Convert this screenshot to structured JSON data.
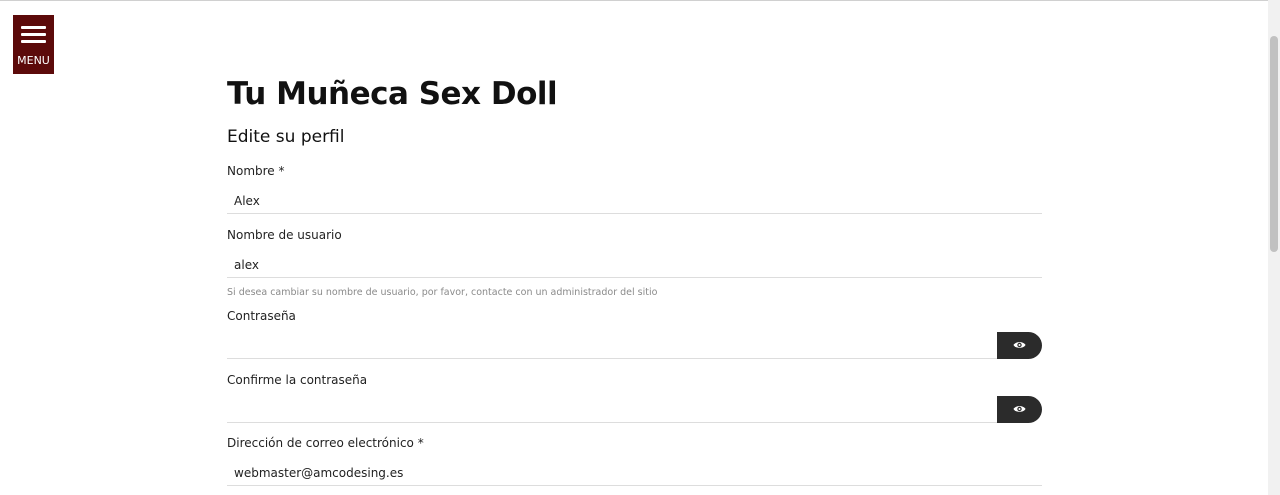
{
  "menu": {
    "label": "MENU"
  },
  "site": {
    "title": "Tu Muñeca Sex Doll"
  },
  "form": {
    "heading": "Edite su perfil",
    "fields": {
      "name": {
        "label": "Nombre *",
        "value": "Alex"
      },
      "username": {
        "label": "Nombre de usuario",
        "value": "alex",
        "help": "Si desea cambiar su nombre de usuario, por favor, contacte con un administrador del sitio"
      },
      "password": {
        "label": "Contraseña",
        "value": "",
        "toggle_icon": "eye-icon"
      },
      "password_confirm": {
        "label": "Confirme la contraseña",
        "value": "",
        "toggle_icon": "eye-icon"
      },
      "email": {
        "label": "Dirección de correo electrónico *",
        "value": "webmaster@amcodesing.es"
      }
    }
  },
  "colors": {
    "menu_bg": "#5c0a0a",
    "toggle_bg": "#2b2b2b"
  }
}
